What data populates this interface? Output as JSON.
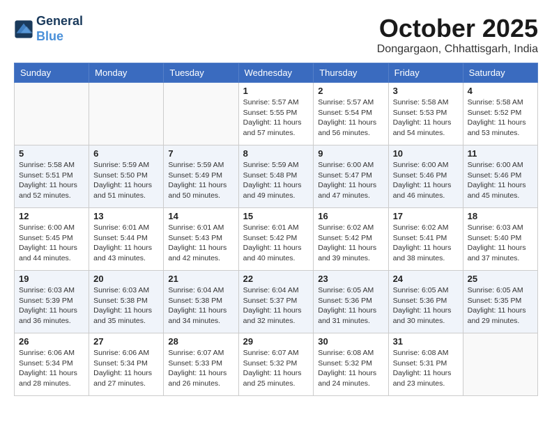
{
  "header": {
    "logo_line1": "General",
    "logo_line2": "Blue",
    "month_title": "October 2025",
    "location": "Dongargaon, Chhattisgarh, India"
  },
  "days_of_week": [
    "Sunday",
    "Monday",
    "Tuesday",
    "Wednesday",
    "Thursday",
    "Friday",
    "Saturday"
  ],
  "weeks": [
    [
      {
        "day": "",
        "info": ""
      },
      {
        "day": "",
        "info": ""
      },
      {
        "day": "",
        "info": ""
      },
      {
        "day": "1",
        "info": "Sunrise: 5:57 AM\nSunset: 5:55 PM\nDaylight: 11 hours\nand 57 minutes."
      },
      {
        "day": "2",
        "info": "Sunrise: 5:57 AM\nSunset: 5:54 PM\nDaylight: 11 hours\nand 56 minutes."
      },
      {
        "day": "3",
        "info": "Sunrise: 5:58 AM\nSunset: 5:53 PM\nDaylight: 11 hours\nand 54 minutes."
      },
      {
        "day": "4",
        "info": "Sunrise: 5:58 AM\nSunset: 5:52 PM\nDaylight: 11 hours\nand 53 minutes."
      }
    ],
    [
      {
        "day": "5",
        "info": "Sunrise: 5:58 AM\nSunset: 5:51 PM\nDaylight: 11 hours\nand 52 minutes."
      },
      {
        "day": "6",
        "info": "Sunrise: 5:59 AM\nSunset: 5:50 PM\nDaylight: 11 hours\nand 51 minutes."
      },
      {
        "day": "7",
        "info": "Sunrise: 5:59 AM\nSunset: 5:49 PM\nDaylight: 11 hours\nand 50 minutes."
      },
      {
        "day": "8",
        "info": "Sunrise: 5:59 AM\nSunset: 5:48 PM\nDaylight: 11 hours\nand 49 minutes."
      },
      {
        "day": "9",
        "info": "Sunrise: 6:00 AM\nSunset: 5:47 PM\nDaylight: 11 hours\nand 47 minutes."
      },
      {
        "day": "10",
        "info": "Sunrise: 6:00 AM\nSunset: 5:46 PM\nDaylight: 11 hours\nand 46 minutes."
      },
      {
        "day": "11",
        "info": "Sunrise: 6:00 AM\nSunset: 5:46 PM\nDaylight: 11 hours\nand 45 minutes."
      }
    ],
    [
      {
        "day": "12",
        "info": "Sunrise: 6:00 AM\nSunset: 5:45 PM\nDaylight: 11 hours\nand 44 minutes."
      },
      {
        "day": "13",
        "info": "Sunrise: 6:01 AM\nSunset: 5:44 PM\nDaylight: 11 hours\nand 43 minutes."
      },
      {
        "day": "14",
        "info": "Sunrise: 6:01 AM\nSunset: 5:43 PM\nDaylight: 11 hours\nand 42 minutes."
      },
      {
        "day": "15",
        "info": "Sunrise: 6:01 AM\nSunset: 5:42 PM\nDaylight: 11 hours\nand 40 minutes."
      },
      {
        "day": "16",
        "info": "Sunrise: 6:02 AM\nSunset: 5:42 PM\nDaylight: 11 hours\nand 39 minutes."
      },
      {
        "day": "17",
        "info": "Sunrise: 6:02 AM\nSunset: 5:41 PM\nDaylight: 11 hours\nand 38 minutes."
      },
      {
        "day": "18",
        "info": "Sunrise: 6:03 AM\nSunset: 5:40 PM\nDaylight: 11 hours\nand 37 minutes."
      }
    ],
    [
      {
        "day": "19",
        "info": "Sunrise: 6:03 AM\nSunset: 5:39 PM\nDaylight: 11 hours\nand 36 minutes."
      },
      {
        "day": "20",
        "info": "Sunrise: 6:03 AM\nSunset: 5:38 PM\nDaylight: 11 hours\nand 35 minutes."
      },
      {
        "day": "21",
        "info": "Sunrise: 6:04 AM\nSunset: 5:38 PM\nDaylight: 11 hours\nand 34 minutes."
      },
      {
        "day": "22",
        "info": "Sunrise: 6:04 AM\nSunset: 5:37 PM\nDaylight: 11 hours\nand 32 minutes."
      },
      {
        "day": "23",
        "info": "Sunrise: 6:05 AM\nSunset: 5:36 PM\nDaylight: 11 hours\nand 31 minutes."
      },
      {
        "day": "24",
        "info": "Sunrise: 6:05 AM\nSunset: 5:36 PM\nDaylight: 11 hours\nand 30 minutes."
      },
      {
        "day": "25",
        "info": "Sunrise: 6:05 AM\nSunset: 5:35 PM\nDaylight: 11 hours\nand 29 minutes."
      }
    ],
    [
      {
        "day": "26",
        "info": "Sunrise: 6:06 AM\nSunset: 5:34 PM\nDaylight: 11 hours\nand 28 minutes."
      },
      {
        "day": "27",
        "info": "Sunrise: 6:06 AM\nSunset: 5:34 PM\nDaylight: 11 hours\nand 27 minutes."
      },
      {
        "day": "28",
        "info": "Sunrise: 6:07 AM\nSunset: 5:33 PM\nDaylight: 11 hours\nand 26 minutes."
      },
      {
        "day": "29",
        "info": "Sunrise: 6:07 AM\nSunset: 5:32 PM\nDaylight: 11 hours\nand 25 minutes."
      },
      {
        "day": "30",
        "info": "Sunrise: 6:08 AM\nSunset: 5:32 PM\nDaylight: 11 hours\nand 24 minutes."
      },
      {
        "day": "31",
        "info": "Sunrise: 6:08 AM\nSunset: 5:31 PM\nDaylight: 11 hours\nand 23 minutes."
      },
      {
        "day": "",
        "info": ""
      }
    ]
  ]
}
